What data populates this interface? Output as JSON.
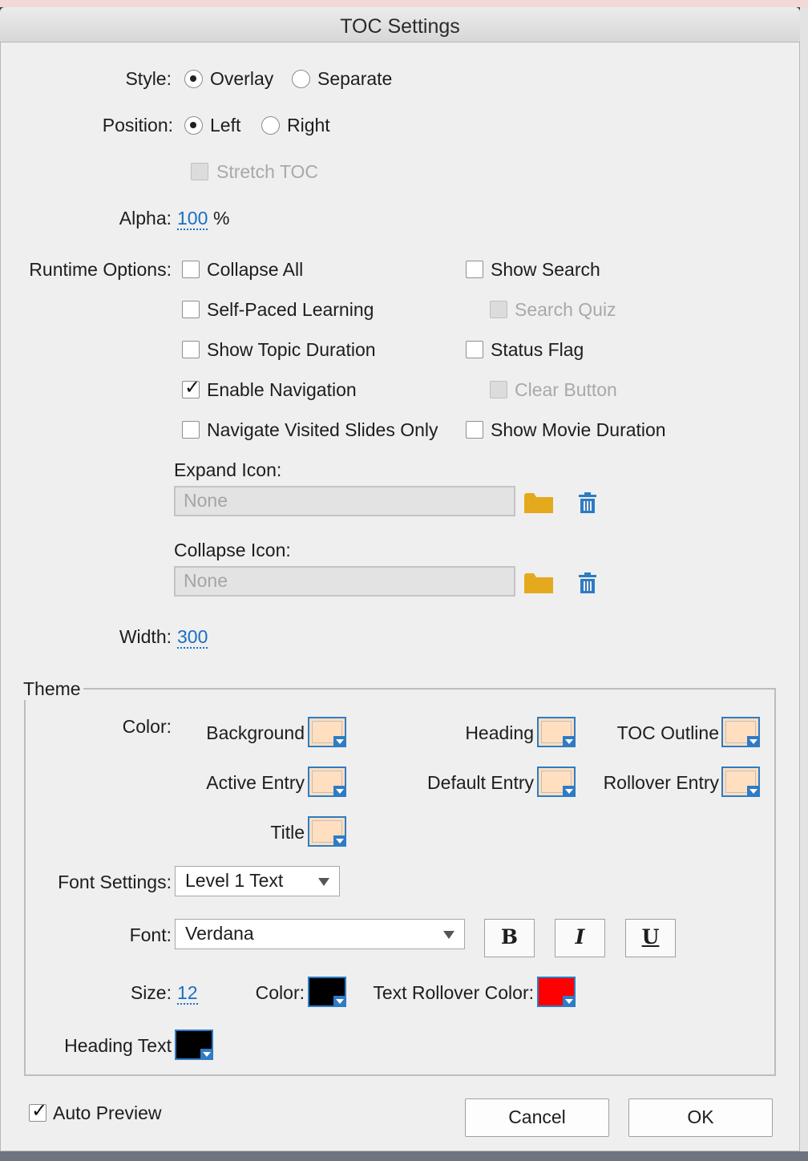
{
  "window": {
    "title": "TOC Settings"
  },
  "style": {
    "label": "Style:",
    "options": [
      "Overlay",
      "Separate"
    ],
    "selected": "Overlay"
  },
  "position": {
    "label": "Position:",
    "options": [
      "Left",
      "Right"
    ],
    "selected": "Left",
    "stretch_label": "Stretch TOC"
  },
  "alpha": {
    "label": "Alpha:",
    "value": "100",
    "unit": "%"
  },
  "runtime": {
    "label": "Runtime Options:",
    "collapse_all": "Collapse All",
    "self_paced": "Self-Paced Learning",
    "show_topic_duration": "Show Topic Duration",
    "enable_navigation": "Enable Navigation",
    "navigate_visited": "Navigate Visited Slides Only",
    "show_search": "Show Search",
    "search_quiz": "Search Quiz",
    "status_flag": "Status Flag",
    "clear_button": "Clear Button",
    "show_movie_duration": "Show Movie Duration"
  },
  "expand_icon": {
    "label": "Expand Icon:",
    "value": "None"
  },
  "collapse_icon": {
    "label": "Collapse Icon:",
    "value": "None"
  },
  "width": {
    "label": "Width:",
    "value": "300"
  },
  "theme": {
    "legend": "Theme",
    "color_label": "Color:",
    "background": "Background",
    "heading": "Heading",
    "toc_outline": "TOC Outline",
    "active_entry": "Active Entry",
    "default_entry": "Default Entry",
    "rollover_entry": "Rollover Entry",
    "title": "Title",
    "swatch_color": "#ffdfc0"
  },
  "font_settings": {
    "label": "Font Settings:",
    "value": "Level 1 Text"
  },
  "font": {
    "label": "Font:",
    "value": "Verdana",
    "bold": "B",
    "italic": "I",
    "underline": "U"
  },
  "size": {
    "label": "Size:",
    "value": "12"
  },
  "text_color": {
    "label": "Color:",
    "value": "#000000"
  },
  "text_rollover": {
    "label": "Text Rollover Color:",
    "value": "#ff0000"
  },
  "heading_text": {
    "label": "Heading Text",
    "value": "#000000"
  },
  "auto_preview": {
    "label": "Auto Preview",
    "checked": true
  },
  "buttons": {
    "cancel": "Cancel",
    "ok": "OK"
  }
}
